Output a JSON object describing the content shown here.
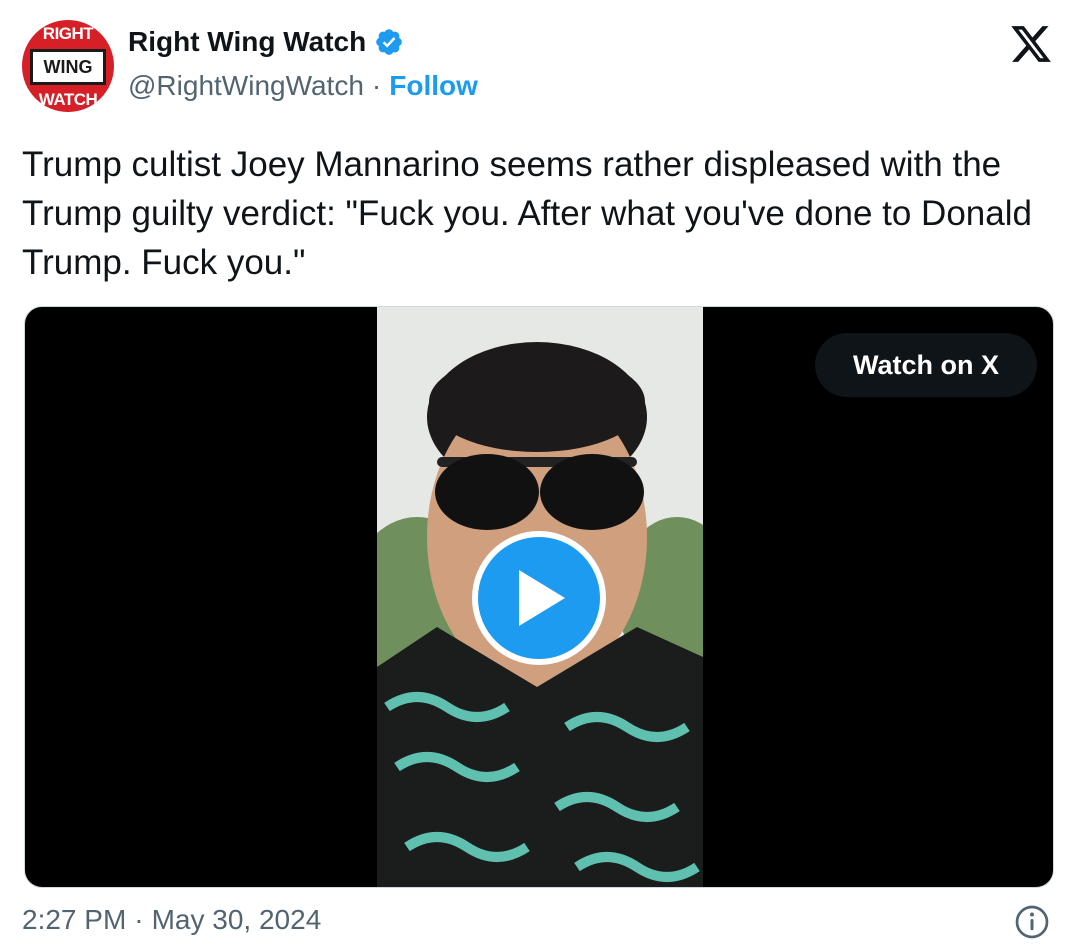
{
  "author": {
    "avatar_text": {
      "top": "RIGHT",
      "middle": "WING",
      "bottom": "WATCH"
    },
    "name": "Right Wing Watch",
    "verified_icon": "verified-badge-icon",
    "handle": "@RightWingWatch",
    "separator": "·",
    "follow_label": "Follow"
  },
  "platform_icon": "x-logo-icon",
  "tweet": {
    "text": "Trump cultist Joey Mannarino seems rather displeased with the Trump guilty verdict: \"Fuck you. After what you've done to Donald Trump. Fuck you.\""
  },
  "media": {
    "watch_label": "Watch on X",
    "play_icon": "play-icon"
  },
  "footer": {
    "time": "2:27 PM",
    "separator": "·",
    "date": "May 30, 2024",
    "info_icon": "info-icon"
  },
  "colors": {
    "accent": "#1d9bf0",
    "text_primary": "#0f1419",
    "text_secondary": "#536471",
    "avatar_red": "#d71f27"
  }
}
